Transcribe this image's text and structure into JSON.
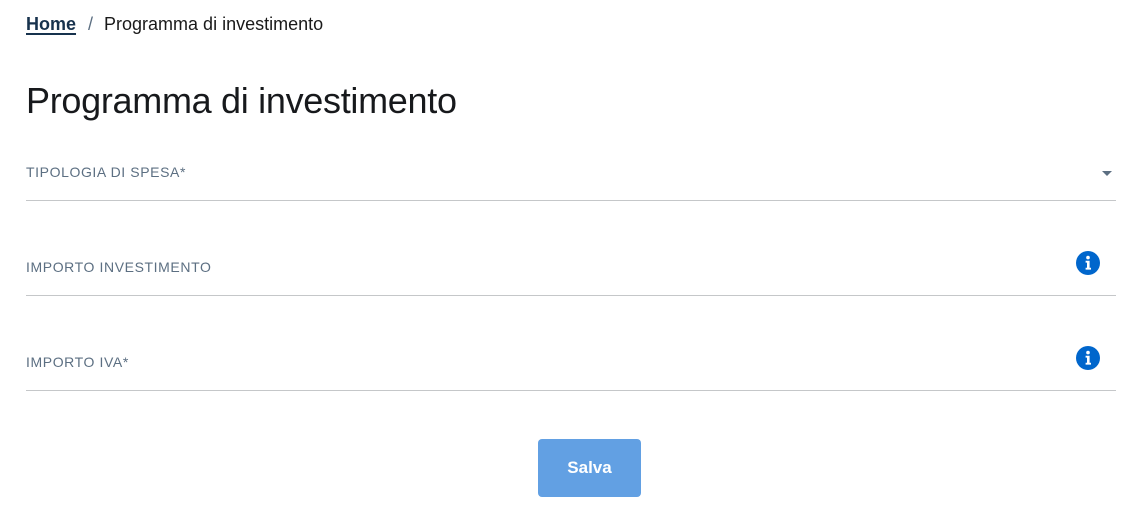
{
  "breadcrumb": {
    "home_label": "Home",
    "separator": "/",
    "current_label": "Programma di investimento"
  },
  "page": {
    "title": "Programma di investimento"
  },
  "form": {
    "tipologia_spesa": {
      "label": "TIPOLOGIA DI SPESA*",
      "value": "",
      "icon": "caret-down-icon"
    },
    "importo_investimento": {
      "label": "IMPORTO INVESTIMENTO",
      "value": "",
      "icon": "info-icon"
    },
    "importo_iva": {
      "label": "IMPORTO IVA*",
      "value": "",
      "icon": "info-icon"
    },
    "save_label": "Salva"
  },
  "colors": {
    "link": "#17324d",
    "info_icon": "#0066cc",
    "button_bg": "#62a0e3",
    "label": "#5c6f82",
    "divider": "#c5c7c9"
  }
}
